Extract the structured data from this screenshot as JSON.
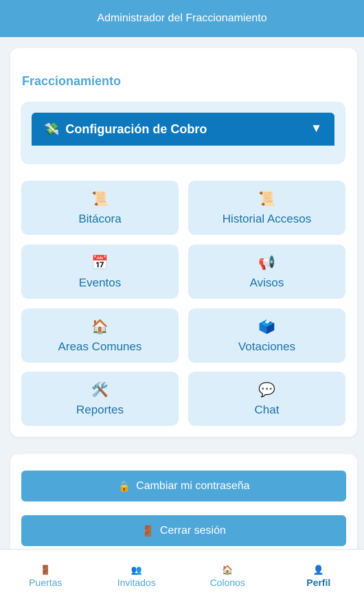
{
  "header": {
    "title": "Administrador del Fraccionamiento"
  },
  "main": {
    "section_title": "Fraccionamiento",
    "billing": {
      "icon": "💸",
      "label": "Configuración de Cobro",
      "caret": "▼"
    },
    "tiles": [
      {
        "icon": "📜",
        "label": "Bitácora"
      },
      {
        "icon": "📜",
        "label": "Historial Accesos"
      },
      {
        "icon": "📅",
        "label": "Eventos"
      },
      {
        "icon": "📢",
        "label": "Avisos"
      },
      {
        "icon": "🏠",
        "label": "Areas Comunes"
      },
      {
        "icon": "🗳️",
        "label": "Votaciones"
      },
      {
        "icon": "🛠️",
        "label": "Reportes"
      },
      {
        "icon": "💬",
        "label": "Chat"
      }
    ]
  },
  "account": {
    "change_password": {
      "icon": "🔒",
      "label": "Cambiar mi contraseña"
    },
    "logout": {
      "icon": "🚪",
      "label": "Cerrar sesión"
    }
  },
  "nav": [
    {
      "icon": "🚪",
      "label": "Puertas"
    },
    {
      "icon": "👥",
      "label": "Invitados"
    },
    {
      "icon": "🏠",
      "label": "Colonos"
    },
    {
      "icon": "👤",
      "label": "Perfil"
    }
  ],
  "colors": {
    "primary": "#4ea7d9",
    "dark_primary": "#0d78bd",
    "tile_bg": "#dceef9",
    "tile_text": "#1b72a7"
  }
}
